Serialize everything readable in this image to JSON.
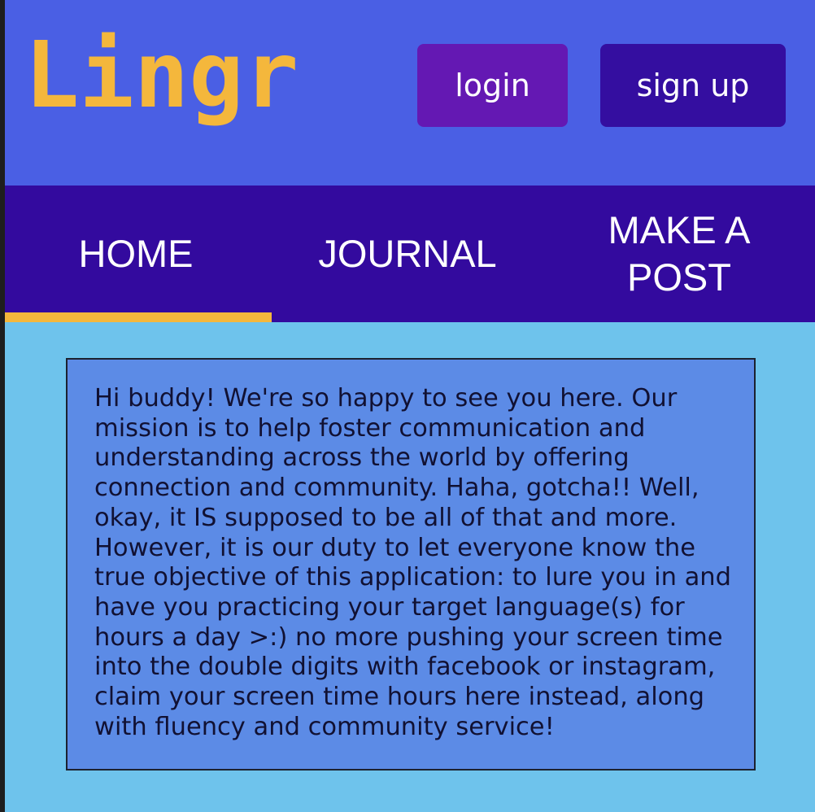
{
  "header": {
    "logo_text": "Lingr",
    "login_label": "login",
    "signup_label": "sign up"
  },
  "nav": {
    "tabs": [
      {
        "label": "HOME",
        "active": true
      },
      {
        "label": "JOURNAL",
        "active": false
      },
      {
        "label": "MAKE A POST",
        "active": false
      }
    ]
  },
  "main": {
    "message": "Hi buddy! We're so happy to see you here. Our mission is to help foster communication and understanding across the world by offering connection and community. Haha, gotcha!! Well, okay, it IS supposed to be all of that and more. However, it is our duty to let everyone know the true objective of this application: to lure you in and have you practicing your target language(s) for hours a day >:) no more pushing your screen time into the double digits with facebook or instagram, claim your screen time hours here instead, along with fluency and community service!"
  },
  "colors": {
    "header_bg": "#4a5fe4",
    "logo": "#f4b73c",
    "login_button": "#6418b3",
    "signup_button": "#340ea0",
    "nav_bg": "#330a9e",
    "active_tab_underline": "#f4b73c",
    "page_bg": "#6ec3ec",
    "message_bg": "#5c8be6"
  }
}
